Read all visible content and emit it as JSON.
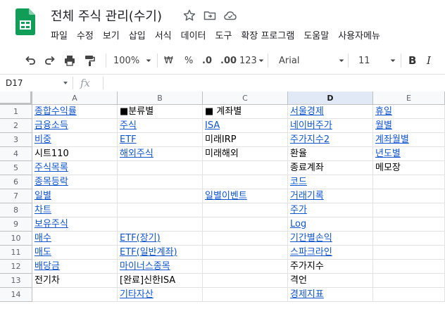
{
  "app": {
    "doc_title": "전체 주식 관리(수기)",
    "menu": [
      "파일",
      "수정",
      "보기",
      "삽입",
      "서식",
      "데이터",
      "도구",
      "확장 프로그램",
      "도움말",
      "사용자메뉴"
    ]
  },
  "toolbar": {
    "zoom": "100%",
    "currency": "₩",
    "percent": "%",
    "dec_decrease": ".0",
    "dec_increase": ".00",
    "number_format": "123",
    "font": "Arial",
    "font_size": "11",
    "bold": "B",
    "italic": "I"
  },
  "formula_bar": {
    "name_box": "D17",
    "fx": "fx"
  },
  "sheet": {
    "columns": [
      "A",
      "B",
      "C",
      "D",
      "E"
    ],
    "selected_column": "D",
    "rows": [
      {
        "n": "1",
        "cells": [
          {
            "t": "종합수익률",
            "l": true
          },
          {
            "t": "■분류별",
            "l": false
          },
          {
            "t": "■ 계좌별",
            "l": false
          },
          {
            "t": "서울경제",
            "l": true
          },
          {
            "t": "휴일",
            "l": true
          }
        ]
      },
      {
        "n": "2",
        "cells": [
          {
            "t": "금융소득",
            "l": true
          },
          {
            "t": "주식",
            "l": true
          },
          {
            "t": "ISA",
            "l": true
          },
          {
            "t": "네이버주가",
            "l": true
          },
          {
            "t": "월별",
            "l": true
          }
        ]
      },
      {
        "n": "3",
        "cells": [
          {
            "t": "비중",
            "l": true
          },
          {
            "t": "ETF",
            "l": true
          },
          {
            "t": "미래IRP",
            "l": false
          },
          {
            "t": "주가지수2",
            "l": true
          },
          {
            "t": "계좌월별",
            "l": true
          }
        ]
      },
      {
        "n": "4",
        "cells": [
          {
            "t": "시트110",
            "l": false
          },
          {
            "t": "해외주식",
            "l": true
          },
          {
            "t": "미래해외",
            "l": false
          },
          {
            "t": "환율",
            "l": false
          },
          {
            "t": "년도별",
            "l": true
          }
        ]
      },
      {
        "n": "5",
        "cells": [
          {
            "t": "주식목록",
            "l": true
          },
          {
            "t": "",
            "l": false
          },
          {
            "t": "",
            "l": false
          },
          {
            "t": "종료계좌",
            "l": false
          },
          {
            "t": "메모장",
            "l": false
          }
        ]
      },
      {
        "n": "6",
        "cells": [
          {
            "t": "종목등락",
            "l": true
          },
          {
            "t": "",
            "l": false
          },
          {
            "t": "",
            "l": false
          },
          {
            "t": "코드",
            "l": true
          },
          {
            "t": "",
            "l": false
          }
        ]
      },
      {
        "n": "7",
        "cells": [
          {
            "t": "일별",
            "l": true
          },
          {
            "t": "",
            "l": false
          },
          {
            "t": "일별이벤트",
            "l": true
          },
          {
            "t": "거래기록",
            "l": true
          },
          {
            "t": "",
            "l": false
          }
        ]
      },
      {
        "n": "8",
        "cells": [
          {
            "t": "차트",
            "l": true
          },
          {
            "t": "",
            "l": false
          },
          {
            "t": "",
            "l": false
          },
          {
            "t": "주가",
            "l": true
          },
          {
            "t": "",
            "l": false
          }
        ]
      },
      {
        "n": "9",
        "cells": [
          {
            "t": "보유주식",
            "l": true
          },
          {
            "t": "",
            "l": false
          },
          {
            "t": "",
            "l": false
          },
          {
            "t": "Log",
            "l": true
          },
          {
            "t": "",
            "l": false
          }
        ]
      },
      {
        "n": "10",
        "cells": [
          {
            "t": "매수",
            "l": true
          },
          {
            "t": "ETF(장기)",
            "l": true
          },
          {
            "t": "",
            "l": false
          },
          {
            "t": "기간별손익",
            "l": true
          },
          {
            "t": "",
            "l": false
          }
        ]
      },
      {
        "n": "11",
        "cells": [
          {
            "t": "매도",
            "l": true
          },
          {
            "t": "ETF(일반계좌)",
            "l": true
          },
          {
            "t": "",
            "l": false
          },
          {
            "t": "스파크라인",
            "l": true
          },
          {
            "t": "",
            "l": false
          }
        ]
      },
      {
        "n": "12",
        "cells": [
          {
            "t": "배당금",
            "l": true
          },
          {
            "t": "마이너스종목",
            "l": true
          },
          {
            "t": "",
            "l": false
          },
          {
            "t": "주가지수",
            "l": false
          },
          {
            "t": "",
            "l": false
          }
        ]
      },
      {
        "n": "13",
        "cells": [
          {
            "t": "전기차",
            "l": false
          },
          {
            "t": "[완료]신한ISA",
            "l": false
          },
          {
            "t": "",
            "l": false
          },
          {
            "t": "격언",
            "l": false
          },
          {
            "t": "",
            "l": false
          }
        ]
      },
      {
        "n": "14",
        "cells": [
          {
            "t": "",
            "l": false
          },
          {
            "t": "기타자산",
            "l": true
          },
          {
            "t": "",
            "l": false
          },
          {
            "t": "경제지표",
            "l": true
          },
          {
            "t": "",
            "l": false
          }
        ]
      }
    ]
  }
}
